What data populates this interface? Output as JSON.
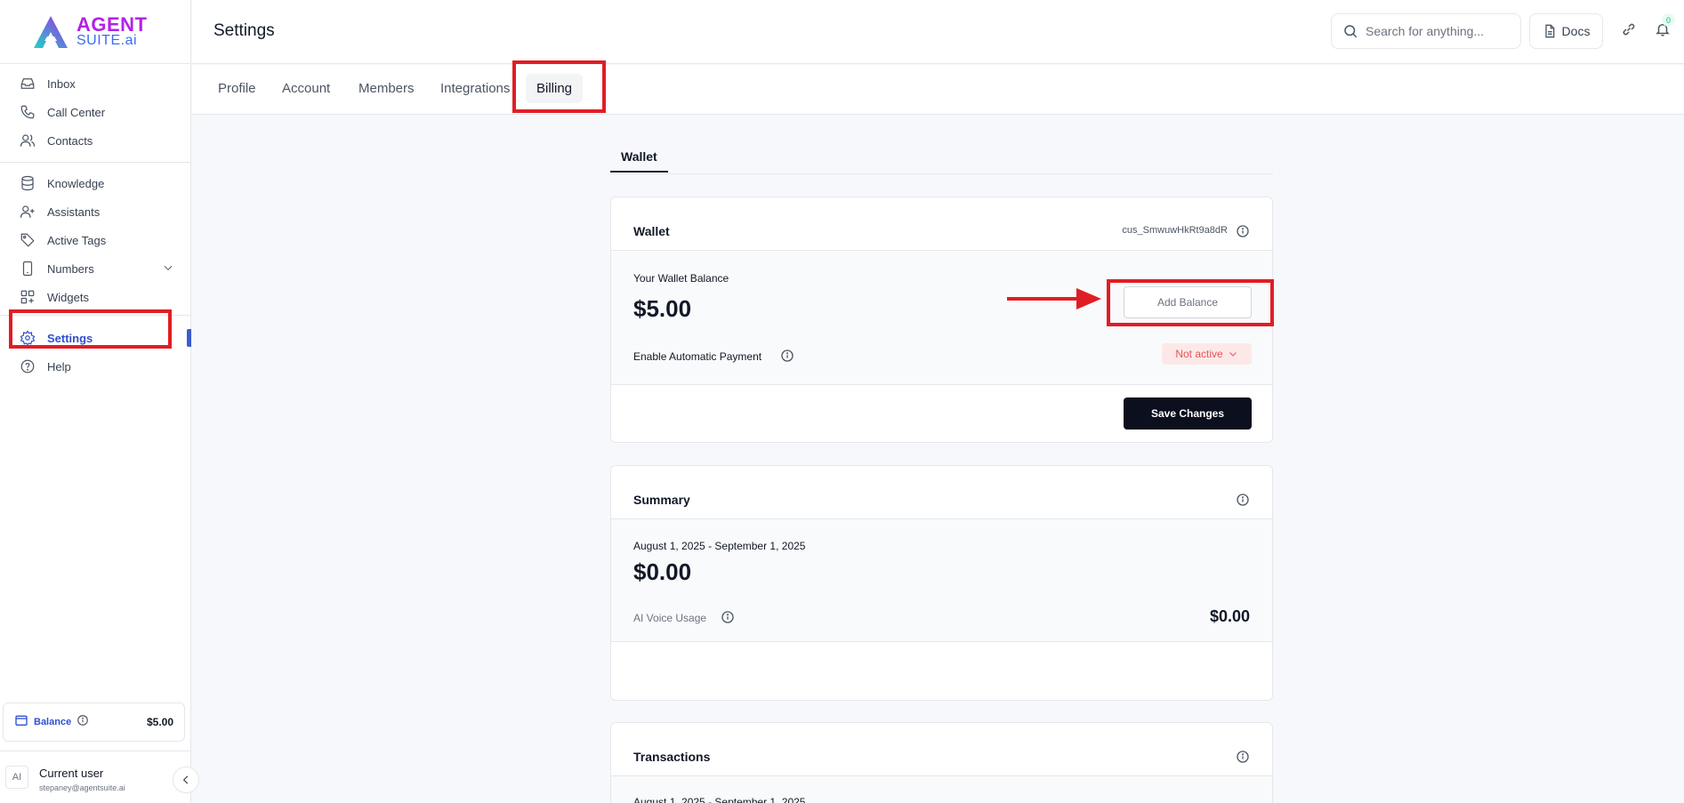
{
  "logo": {
    "line1": "AGENT",
    "line2": "SUITE.ai"
  },
  "sidebar": {
    "groups": [
      [
        {
          "label": "Inbox"
        },
        {
          "label": "Call Center"
        },
        {
          "label": "Contacts"
        }
      ],
      [
        {
          "label": "Knowledge"
        },
        {
          "label": "Assistants"
        },
        {
          "label": "Active Tags"
        },
        {
          "label": "Numbers"
        },
        {
          "label": "Widgets"
        }
      ],
      [
        {
          "label": "Settings"
        },
        {
          "label": "Help"
        }
      ]
    ],
    "balance_label": "Balance",
    "balance_amount": "$5.00",
    "user": {
      "initials": "AI",
      "name": "Current user",
      "email": "stepaney@agentsuite.ai"
    }
  },
  "header": {
    "title": "Settings",
    "search_placeholder": "Search for anything...",
    "docs_label": "Docs",
    "notification_count": "0"
  },
  "tabs": [
    "Profile",
    "Account",
    "Members",
    "Integrations",
    "Billing"
  ],
  "active_tab": "Billing",
  "sub_tab": "Wallet",
  "wallet": {
    "title": "Wallet",
    "customer_id": "cus_SmwuwHkRt9a8dR",
    "balance_label": "Your Wallet Balance",
    "balance": "$5.00",
    "add_balance": "Add Balance",
    "auto_payment_label": "Enable Automatic Payment",
    "auto_payment_status": "Not active",
    "save_label": "Save Changes"
  },
  "summary": {
    "title": "Summary",
    "period": "August 1, 2025 - September 1, 2025",
    "total": "$0.00",
    "usage_label": "AI Voice Usage",
    "usage_amount": "$0.00"
  },
  "transactions": {
    "title": "Transactions",
    "period": "August 1, 2025 - September 1, 2025"
  },
  "colors": {
    "accent": "#2f4fd0",
    "highlight": "#e11d24",
    "dark_button": "#0b0f1e"
  }
}
